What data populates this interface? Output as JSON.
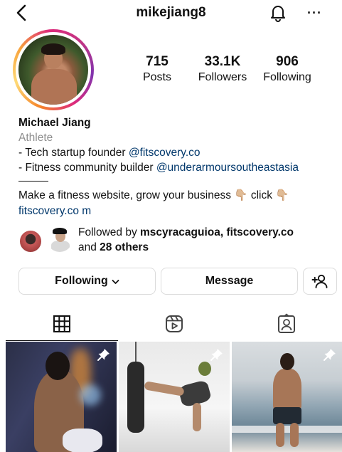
{
  "header": {
    "username": "mikejiang8",
    "back_icon": "chevron-left-icon",
    "bell_icon": "bell-icon",
    "more_icon": "more-horizontal-icon",
    "more_label": "···"
  },
  "profile": {
    "avatar_icon": "profile-avatar",
    "stats": [
      {
        "value": "715",
        "label": "Posts"
      },
      {
        "value": "33.1K",
        "label": "Followers"
      },
      {
        "value": "906",
        "label": "Following"
      }
    ]
  },
  "bio": {
    "name": "Michael Jiang",
    "category": "Athlete",
    "line1_text": "- Tech startup founder ",
    "line1_link": "@fitscovery.co",
    "line2_text": "- Fitness community builder ",
    "line2_link": "@underarmoursoutheastasia",
    "line3": "Make a fitness website, grow your business 👇🏼 click 👇🏼",
    "website": "fitscovery.co m"
  },
  "followed_by": {
    "prefix": "Followed by ",
    "users": "mscyracaguioa, fitscovery.co",
    "and": "and ",
    "others": "28 others"
  },
  "buttons": {
    "following": "Following",
    "message": "Message",
    "add_icon": "add-person-icon"
  },
  "tabs": [
    {
      "name": "grid",
      "icon": "grid-icon",
      "active": true
    },
    {
      "name": "reels",
      "icon": "reels-icon",
      "active": false
    },
    {
      "name": "tagged",
      "icon": "tagged-icon",
      "active": false
    }
  ],
  "posts": [
    {
      "pinned": true,
      "icon": "pin-icon"
    },
    {
      "pinned": true,
      "icon": "pin-icon"
    },
    {
      "pinned": true,
      "icon": "pin-icon"
    }
  ],
  "colors": {
    "link": "#00376b",
    "secondary_text": "#8e8e8e",
    "border": "#dbdbdb",
    "story_ring": [
      "#f58529",
      "#feda77",
      "#dd2a7b",
      "#8134af"
    ]
  }
}
